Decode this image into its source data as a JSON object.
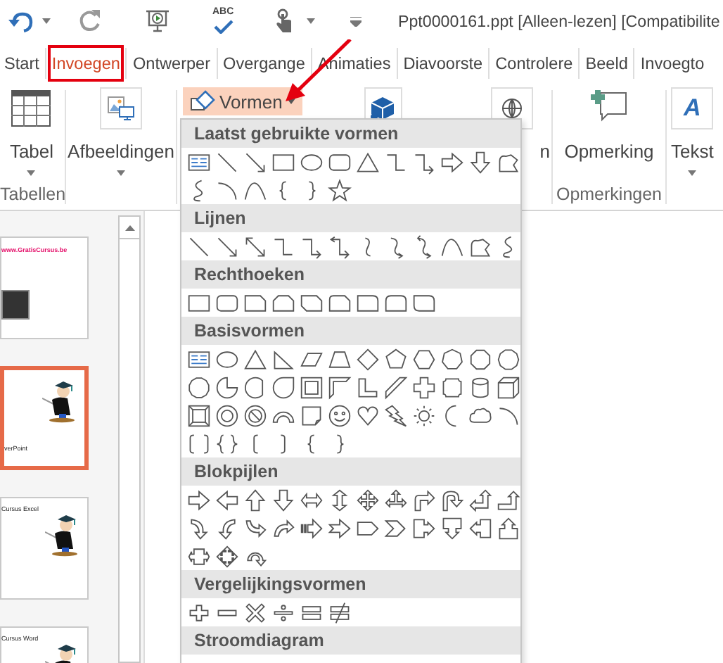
{
  "title_bar": {
    "spelling_label": "ABC",
    "title": "Ppt0000161.ppt [Alleen-lezen] [Compatibilite"
  },
  "tabs": [
    {
      "label": "Start",
      "selected": false,
      "marked": false
    },
    {
      "label": "Invoegen",
      "selected": true,
      "marked": true
    },
    {
      "label": "Ontwerper",
      "selected": false,
      "marked": false
    },
    {
      "label": "Overgange",
      "selected": false,
      "marked": false
    },
    {
      "label": "Animaties",
      "selected": false,
      "marked": false
    },
    {
      "label": "Diavoorste",
      "selected": false,
      "marked": false
    },
    {
      "label": "Controlere",
      "selected": false,
      "marked": false
    },
    {
      "label": "Beeld",
      "selected": false,
      "marked": false
    },
    {
      "label": "Invoegto",
      "selected": false,
      "marked": false
    }
  ],
  "ribbon": {
    "tabel": {
      "label": "Tabel",
      "group": "Tabellen"
    },
    "afbeeldingen": {
      "label": "Afbeeldingen"
    },
    "vormen": {
      "label": "Vormen",
      "pressed": true
    },
    "fragment": "n",
    "opmerking": {
      "label": "Opmerking",
      "group": "Opmerkingen"
    },
    "tekst": {
      "label": "Tekst",
      "icon_glyph": "A"
    }
  },
  "shape_menu": {
    "sections": [
      {
        "title": "Laatst gebruikte vormen"
      },
      {
        "title": "Lijnen"
      },
      {
        "title": "Rechthoeken"
      },
      {
        "title": "Basisvormen"
      },
      {
        "title": "Blokpijlen"
      },
      {
        "title": "Vergelijkingsvormen"
      },
      {
        "title": "Stroomdiagram"
      }
    ]
  },
  "slides": [
    {
      "kind": "title",
      "selected": false,
      "text": "www.GratisCursus.be"
    },
    {
      "kind": "figure-bottom",
      "selected": true,
      "text": "verPoint"
    },
    {
      "kind": "figure-top",
      "selected": false,
      "text": "Cursus Excel"
    },
    {
      "kind": "figure-top",
      "selected": false,
      "text": "Cursus Word"
    }
  ]
}
